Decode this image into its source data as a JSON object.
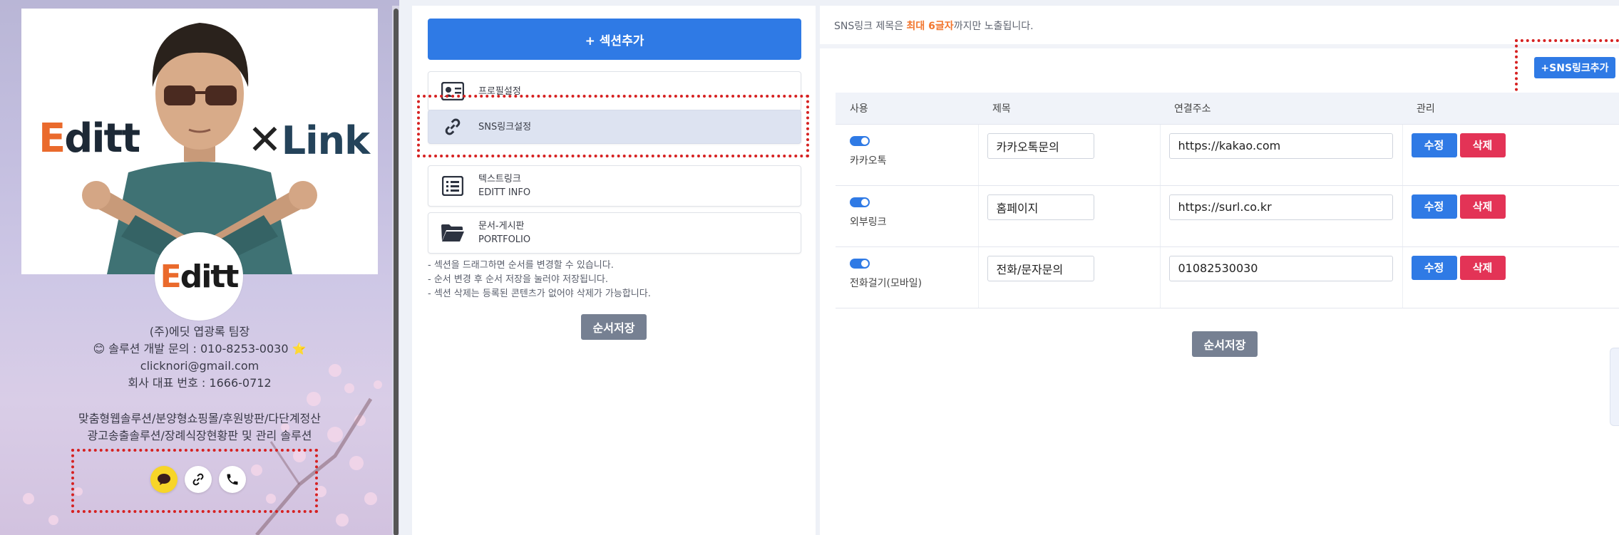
{
  "preview": {
    "brand_left_e": "E",
    "brand_left_rest": "ditt",
    "brand_right_x": "✕",
    "brand_right_rest": "Link",
    "avatar_e": "E",
    "avatar_rest": "ditt",
    "profile_lines": [
      "(주)에딧 엽광록 팀장",
      "😊 솔루션 개발 문의 : 010-8253-0030 ⭐",
      "clicknori@gmail.com",
      "회사 대표 번호 : 1666-0712"
    ],
    "service_lines": [
      "맞춤형웹솔루션/분양형쇼핑몰/후원방판/다단계정산",
      "광고송출솔루션/장례식장현황판 및 관리 솔루션"
    ],
    "sns_icons": [
      "kakao-talk-icon",
      "link-icon",
      "phone-icon"
    ]
  },
  "middle": {
    "add_section_label": "+ 섹션추가",
    "sections": [
      {
        "icon": "profile-card-icon",
        "title": "프로필설정",
        "subtitle": ""
      },
      {
        "icon": "link-icon",
        "title": "SNS링크설정",
        "subtitle": ""
      },
      {
        "icon": "list-icon",
        "title": "텍스트링크",
        "subtitle": "EDITT INFO"
      },
      {
        "icon": "folder-icon",
        "title": "문서-게시판",
        "subtitle": "PORTFOLIO"
      }
    ],
    "notes": [
      "- 섹션을 드래그하면 순서를 변경할 수 있습니다.",
      "- 순서 변경 후 순서 저장을 눌러야 저장됩니다.",
      "- 섹션 삭제는 등록된 콘텐츠가 없어야 삭제가 가능합니다."
    ],
    "order_save_label": "순서저장"
  },
  "right": {
    "notice_pre": "SNS링크 제목은 ",
    "notice_highlight": "최대 6글자",
    "notice_post": "까지만 노출됩니다.",
    "add_sns_label": "+SNS링크추가",
    "columns": [
      "사용",
      "제목",
      "연결주소",
      "관리"
    ],
    "rows": [
      {
        "type": "카카오톡",
        "title": "카카오톡문의",
        "url": "https://kakao.com",
        "enabled": true
      },
      {
        "type": "외부링크",
        "title": "홈페이지",
        "url": "https://surl.co.kr",
        "enabled": true
      },
      {
        "type": "전화걸기(모바일)",
        "title": "전화/문자문의",
        "url": "01082530030",
        "enabled": true
      }
    ],
    "edit_label": "수정",
    "delete_label": "삭제",
    "order_save_label": "순서저장"
  },
  "colors": {
    "primary": "#2f7ae5",
    "danger": "#e33356",
    "highlight": "#f2762e",
    "save_gray": "#768092",
    "annotation_red": "#d62121"
  }
}
